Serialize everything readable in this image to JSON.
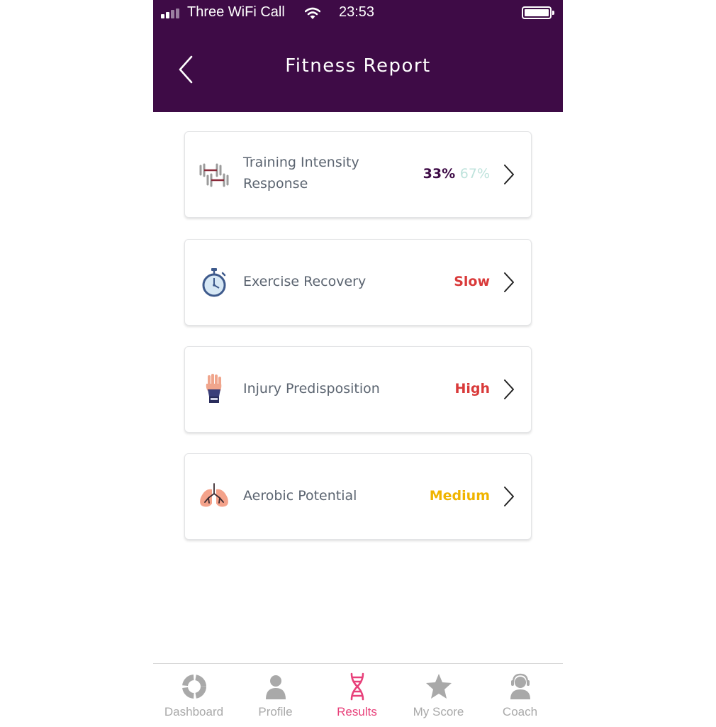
{
  "status_bar": {
    "carrier": "Three WiFi Call",
    "time": "23:53"
  },
  "header": {
    "title": "Fitness Report"
  },
  "colors": {
    "header_bg": "#3e0b46",
    "label": "#5b6470",
    "value_dark": "#3e0b46",
    "value_light": "#bfe3dc",
    "red": "#d93a3a",
    "yellow": "#f0b400",
    "nav_active": "#e8407a",
    "nav_inactive": "#a9a9a9"
  },
  "cards": [
    {
      "id": "training",
      "label_line1": "Training Intensity",
      "label_line2": "Response",
      "value_primary": "33%",
      "value_secondary": "67%",
      "icon": "dumbbell-icon"
    },
    {
      "id": "recovery",
      "label": "Exercise Recovery",
      "value": "Slow",
      "icon": "stopwatch-icon"
    },
    {
      "id": "injury",
      "label": "Injury Predisposition",
      "value": "High",
      "icon": "hand-wrap-icon"
    },
    {
      "id": "aerobic",
      "label": "Aerobic Potential",
      "value": "Medium",
      "icon": "lungs-icon"
    }
  ],
  "bottom_nav": [
    {
      "label": "Dashboard",
      "icon": "dashboard-icon",
      "active": false
    },
    {
      "label": "Profile",
      "icon": "person-icon",
      "active": false
    },
    {
      "label": "Results",
      "icon": "dna-icon",
      "active": true
    },
    {
      "label": "My Score",
      "icon": "star-icon",
      "active": false
    },
    {
      "label": "Coach",
      "icon": "headset-icon",
      "active": false
    }
  ]
}
